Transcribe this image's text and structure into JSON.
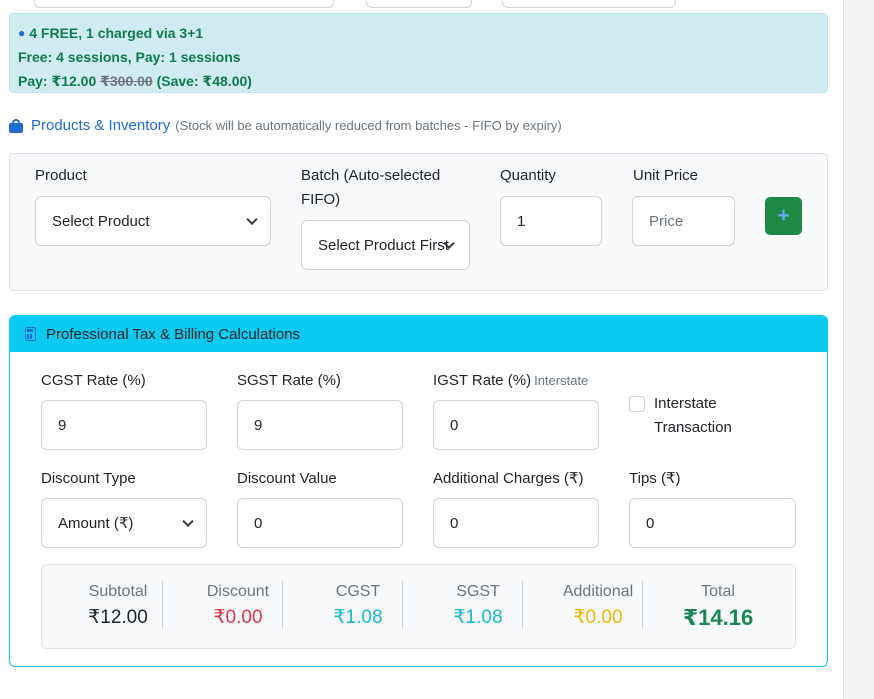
{
  "promo": {
    "line1": "4 FREE, 1 charged via 3+1",
    "line2": "Free: 4 sessions, Pay: 1 sessions",
    "line3_prefix": "Pay: ₹12.00",
    "line3_strike": "₹300.00",
    "line3_save": "(Save: ₹48.00)"
  },
  "products": {
    "title": "Products & Inventory",
    "note": "(Stock will be automatically reduced from batches - FIFO by expiry)",
    "product_label": "Product",
    "product_value": "Select Product",
    "batch_label": "Batch (Auto-selected FIFO)",
    "batch_value": "Select Product First",
    "quantity_label": "Quantity",
    "quantity_value": "1",
    "unit_price_label": "Unit Price",
    "unit_price_placeholder": "Price",
    "add_symbol": "+"
  },
  "tax": {
    "title": "Professional Tax & Billing Calculations",
    "cgst_label": "CGST Rate (%)",
    "cgst_value": "9",
    "sgst_label": "SGST Rate (%)",
    "sgst_value": "9",
    "igst_label": "IGST Rate (%)",
    "igst_note": "Interstate",
    "igst_value": "0",
    "interstate_label": "Interstate Transaction",
    "discount_type_label": "Discount Type",
    "discount_type_value": "Amount (₹)",
    "discount_value_label": "Discount Value",
    "discount_value": "0",
    "additional_label": "Additional Charges (₹)",
    "additional_value": "0",
    "tips_label": "Tips (₹)",
    "tips_value": "0"
  },
  "summary": {
    "subtotal_label": "Subtotal",
    "subtotal_value": "₹12.00",
    "discount_label": "Discount",
    "discount_value": "₹0.00",
    "cgst_label": "CGST",
    "cgst_value": "₹1.08",
    "sgst_label": "SGST",
    "sgst_value": "₹1.08",
    "additional_label": "Additional",
    "additional_value": "₹0.00",
    "total_label": "Total",
    "total_value": "₹14.16"
  },
  "colors": {
    "accent": "#0dcaf0",
    "primary": "#1f6bd1",
    "success": "#1e8a45",
    "danger": "#dc3545",
    "warning": "#f0b400",
    "info": "#14b8d4"
  }
}
